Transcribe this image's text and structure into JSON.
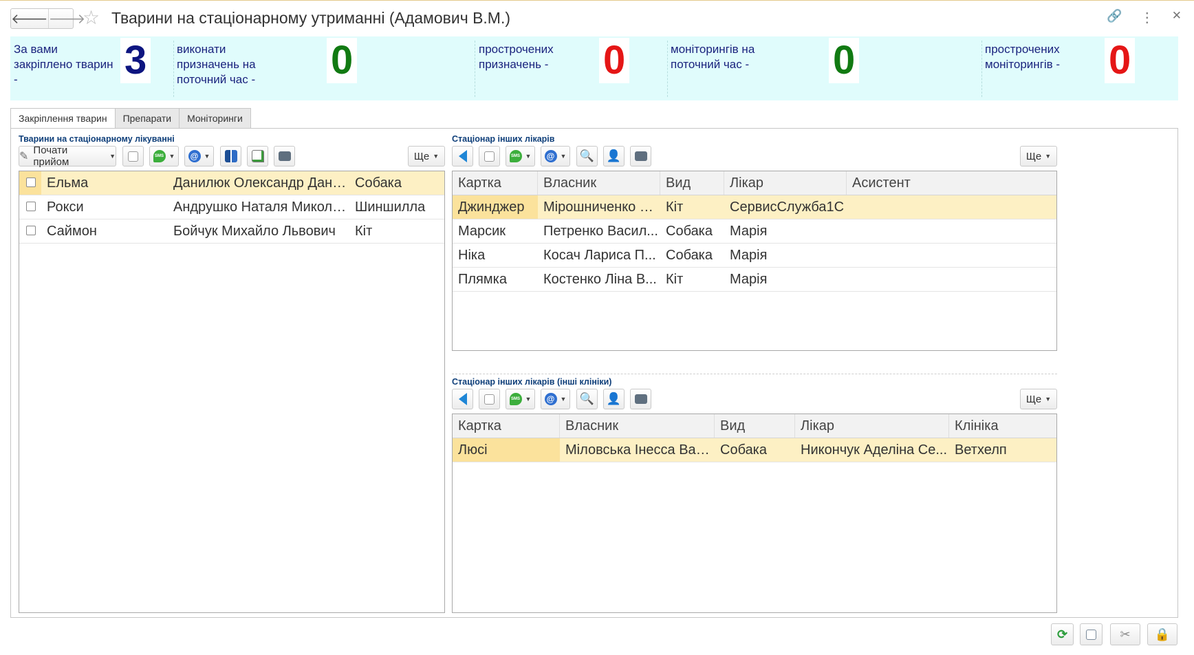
{
  "window": {
    "title": "Тварини на стаціонарному утриманні (Адамович В.М.)",
    "back_glyph": "🡐",
    "forward_glyph": "🡒",
    "star_glyph": "☆",
    "link_glyph": "🔗",
    "menu_glyph": "⋮",
    "close_glyph": "✕"
  },
  "stats": [
    {
      "label": "За вами закріплено тварин -",
      "value": "3",
      "color": "#0d1580"
    },
    {
      "label": "виконати призначень на поточний час -",
      "value": "0",
      "color": "#117a12"
    },
    {
      "label": "прострочених призначень -",
      "value": "0",
      "color": "#e51616"
    },
    {
      "label": "моніторингів на поточний час -",
      "value": "0",
      "color": "#117a12"
    },
    {
      "label": "прострочених моніторингів -",
      "value": "0",
      "color": "#e51616"
    }
  ],
  "tabs": [
    "Закріплення тварин",
    "Препарати",
    "Моніторинги"
  ],
  "left_panel": {
    "title": "Тварини на стаціонарному лікуванні",
    "start_button": "Почати прийом",
    "more_button": "Ще",
    "rows": [
      {
        "name": "Ельма",
        "owner": "Данилюк Олександр Дани...",
        "species": "Собака"
      },
      {
        "name": "Рокси",
        "owner": "Андрушко Наталя Миколаї...",
        "species": "Шиншилла"
      },
      {
        "name": "Саймон",
        "owner": "Бойчук Михайло Львович",
        "species": "Кіт"
      }
    ]
  },
  "other_doctors": {
    "title": "Стаціонар інших лікарів",
    "more_button": "Ще",
    "columns": [
      "Картка",
      "Власник",
      "Вид",
      "Лікар",
      "Асистент"
    ],
    "rows": [
      {
        "card": "Джинджер",
        "owner": "Мірошниченко Є...",
        "species": "Кіт",
        "doctor": "СервисСлужба1С",
        "assistant": ""
      },
      {
        "card": "Марсик",
        "owner": "Петренко Васил...",
        "species": "Собака",
        "doctor": "Марія",
        "assistant": ""
      },
      {
        "card": "Ніка",
        "owner": "Косач Лариса П...",
        "species": "Собака",
        "doctor": "Марія",
        "assistant": ""
      },
      {
        "card": "Плямка",
        "owner": "Костенко Ліна В...",
        "species": "Кіт",
        "doctor": "Марія",
        "assistant": ""
      }
    ]
  },
  "other_clinics": {
    "title": "Стаціонар інших лікарів (інші клініки)",
    "more_button": "Ще",
    "columns": [
      "Картка",
      "Власник",
      "Вид",
      "Лікар",
      "Клініка"
    ],
    "rows": [
      {
        "card": "Люсі",
        "owner": "Міловська Інесса Вал...",
        "species": "Собака",
        "doctor": "Никончук Аделіна Се...",
        "clinic": "Ветхелп"
      }
    ]
  },
  "icons": {
    "pencil": "✎",
    "search": "🔍",
    "person": "👤",
    "refresh": "⟳",
    "settings": "✂",
    "lock": "🔒"
  }
}
